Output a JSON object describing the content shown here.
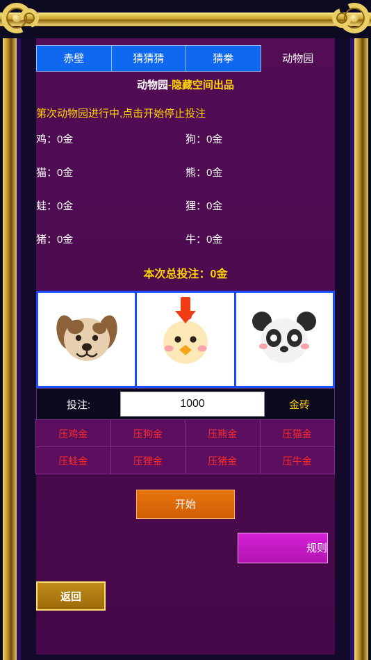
{
  "app": {
    "tabs": [
      {
        "label": "赤壁",
        "active": true
      },
      {
        "label": "猜猜猜",
        "active": true
      },
      {
        "label": "猜拳",
        "active": true
      },
      {
        "label": "动物园",
        "active": false
      }
    ],
    "subtitle_white": "动物园",
    "subtitle_sep": "-",
    "subtitle_yellow": "隐藏空间出品",
    "status_text": "第次动物园进行中,点击开始停止投注"
  },
  "bets": [
    {
      "name": "鸡",
      "value": "0金"
    },
    {
      "name": "狗",
      "value": "0金"
    },
    {
      "name": "猫",
      "value": "0金"
    },
    {
      "name": "熊",
      "value": "0金"
    },
    {
      "name": "蛙",
      "value": "0金"
    },
    {
      "name": "狸",
      "value": "0金"
    },
    {
      "name": "猪",
      "value": "0金"
    },
    {
      "name": "牛",
      "value": "0金"
    }
  ],
  "total_label": "本次总投注：",
  "total_value": "0金",
  "animals": [
    {
      "icon": "dog-icon",
      "selected": false
    },
    {
      "icon": "chicken-icon",
      "selected": true
    },
    {
      "icon": "panda-icon",
      "selected": false
    }
  ],
  "input_row": {
    "label": "投注:",
    "value": "1000",
    "placeholder": "1000",
    "unit": "金砖"
  },
  "bet_buttons": [
    "压鸡金",
    "压狗金",
    "压熊金",
    "压猫金",
    "压蛙金",
    "压狸金",
    "压猪金",
    "压牛金"
  ],
  "actions": {
    "start": "开始",
    "rule": "规则",
    "back": "返回"
  },
  "colors": {
    "tab_active": "#1068f0",
    "page_bg": "#4d0b50",
    "accent_yellow": "#ffd400",
    "bet_text_red": "#ff2b2b",
    "start_orange": "#e8740d",
    "rule_magenta": "#d61fd6",
    "frame_gold": "#e9cf66"
  }
}
